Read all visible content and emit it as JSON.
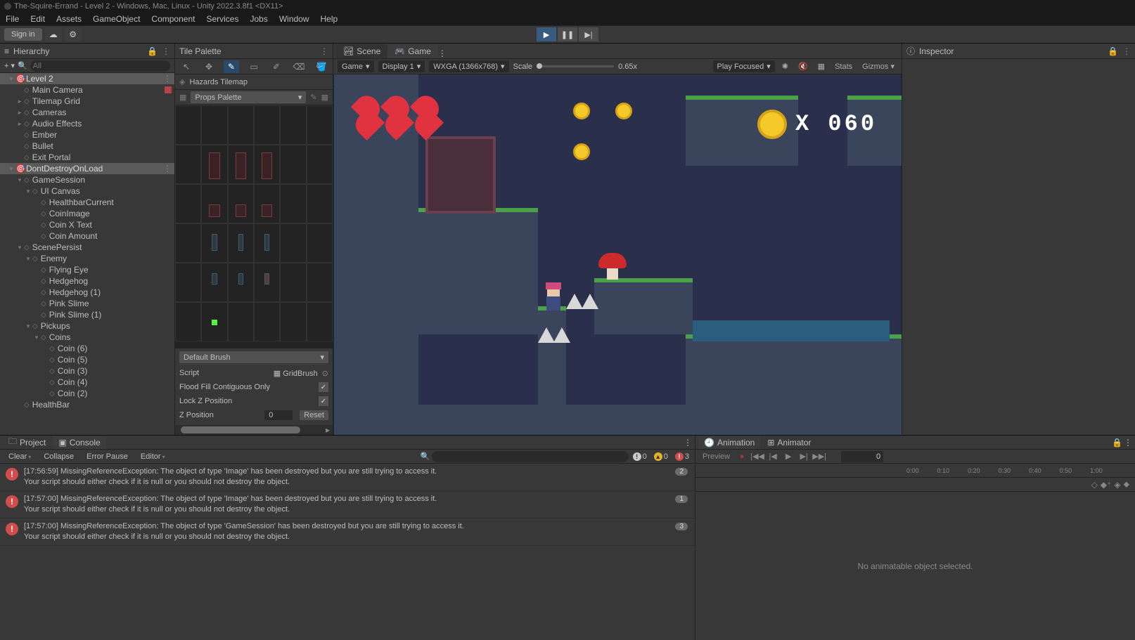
{
  "window": {
    "title": "The-Squire-Errand - Level 2 - Windows, Mac, Linux - Unity 2022.3.8f1 <DX11>"
  },
  "menu": [
    "File",
    "Edit",
    "Assets",
    "GameObject",
    "Component",
    "Services",
    "Jobs",
    "Window",
    "Help"
  ],
  "toolbar": {
    "signin": "Sign in"
  },
  "hierarchy": {
    "title": "Hierarchy",
    "search_placeholder": "All",
    "scene": "Level 2",
    "items": {
      "main_camera": "Main Camera",
      "tilemap_grid": "Tilemap Grid",
      "cameras": "Cameras",
      "audio_effects": "Audio Effects",
      "ember": "Ember",
      "bullet": "Bullet",
      "exit_portal": "Exit Portal",
      "ddol": "DontDestroyOnLoad",
      "game_session": "GameSession",
      "ui_canvas": "UI Canvas",
      "healthbar": "HealthbarCurrent",
      "coin_image": "CoinImage",
      "coin_x_text": "Coin X Text",
      "coin_amount": "Coin Amount",
      "scene_persist": "ScenePersist",
      "enemy": "Enemy",
      "flying_eye": "Flying Eye",
      "hedgehog": "Hedgehog",
      "hedgehog_1": "Hedgehog (1)",
      "pink_slime": "Pink Slime",
      "pink_slime_1": "Pink Slime  (1)",
      "pickups": "Pickups",
      "coins": "Coins",
      "coin6": "Coin (6)",
      "coin5": "Coin (5)",
      "coin3": "Coin (3)",
      "coin4": "Coin (4)",
      "coin2": "Coin (2)",
      "health_bar": "HealthBar"
    }
  },
  "tilepalette": {
    "title": "Tile Palette",
    "active_map": "Hazards Tilemap",
    "palette": "Props Palette",
    "brush": "Default Brush",
    "script_label": "Script",
    "script_value": "GridBrush",
    "flood": "Flood Fill Contiguous Only",
    "lockz": "Lock Z Position",
    "zpos_label": "Z Position",
    "zpos_value": "0",
    "reset": "Reset"
  },
  "game": {
    "tab_scene": "Scene",
    "tab_game": "Game",
    "mode": "Game",
    "display": "Display 1",
    "resolution": "WXGA (1366x768)",
    "scale_label": "Scale",
    "scale_value": "0.65x",
    "focus": "Play Focused",
    "stats": "Stats",
    "gizmos": "Gizmos",
    "hud_score": "X 060"
  },
  "inspector": {
    "title": "Inspector"
  },
  "console": {
    "tab_project": "Project",
    "tab_console": "Console",
    "clear": "Clear",
    "collapse": "Collapse",
    "error_pause": "Error Pause",
    "editor": "Editor",
    "count_info": "0",
    "count_warn": "0",
    "count_err": "3",
    "msgs": [
      {
        "t": "[17:56:59] MissingReferenceException: The object of type 'Image' has been destroyed but you are still trying to access it.\nYour script should either check if it is null or you should not destroy the object.",
        "c": "2"
      },
      {
        "t": "[17:57:00] MissingReferenceException: The object of type 'Image' has been destroyed but you are still trying to access it.\nYour script should either check if it is null or you should not destroy the object.",
        "c": "1"
      },
      {
        "t": "[17:57:00] MissingReferenceException: The object of type 'GameSession' has been destroyed but you are still trying to access it.\nYour script should either check if it is null or you should not destroy the object.",
        "c": "3"
      }
    ]
  },
  "animation": {
    "tab_animation": "Animation",
    "tab_animator": "Animator",
    "preview": "Preview",
    "frame": "0",
    "ticks": [
      "0:00",
      "0:10",
      "0:20",
      "0:30",
      "0:40",
      "0:50",
      "1:00"
    ],
    "empty": "No animatable object selected."
  }
}
